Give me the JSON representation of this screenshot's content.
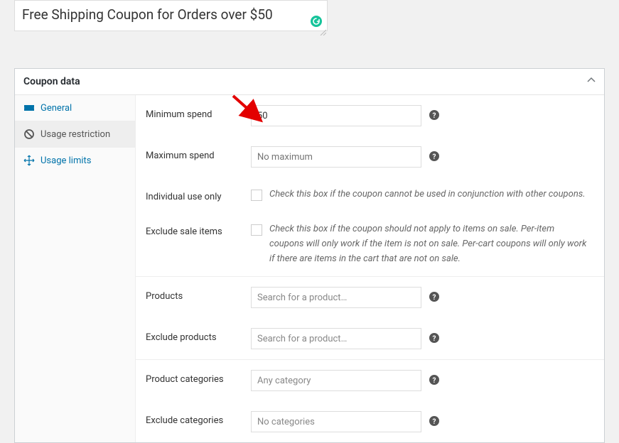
{
  "description": "Free Shipping Coupon for Orders over $50",
  "panel_title": "Coupon data",
  "tabs": {
    "general": "General",
    "usage_restriction": "Usage restriction",
    "usage_limits": "Usage limits"
  },
  "fields": {
    "min_spend": {
      "label": "Minimum spend",
      "value": "50"
    },
    "max_spend": {
      "label": "Maximum spend",
      "placeholder": "No maximum"
    },
    "individual_use": {
      "label": "Individual use only",
      "desc": "Check this box if the coupon cannot be used in conjunction with other coupons."
    },
    "exclude_sale": {
      "label": "Exclude sale items",
      "desc": "Check this box if the coupon should not apply to items on sale. Per-item coupons will only work if the item is not on sale. Per-cart coupons will only work if there are items in the cart that are not on sale."
    },
    "products": {
      "label": "Products",
      "placeholder": "Search for a product…"
    },
    "exclude_products": {
      "label": "Exclude products",
      "placeholder": "Search for a product…"
    },
    "product_categories": {
      "label": "Product categories",
      "placeholder": "Any category"
    },
    "exclude_categories": {
      "label": "Exclude categories",
      "placeholder": "No categories"
    }
  }
}
